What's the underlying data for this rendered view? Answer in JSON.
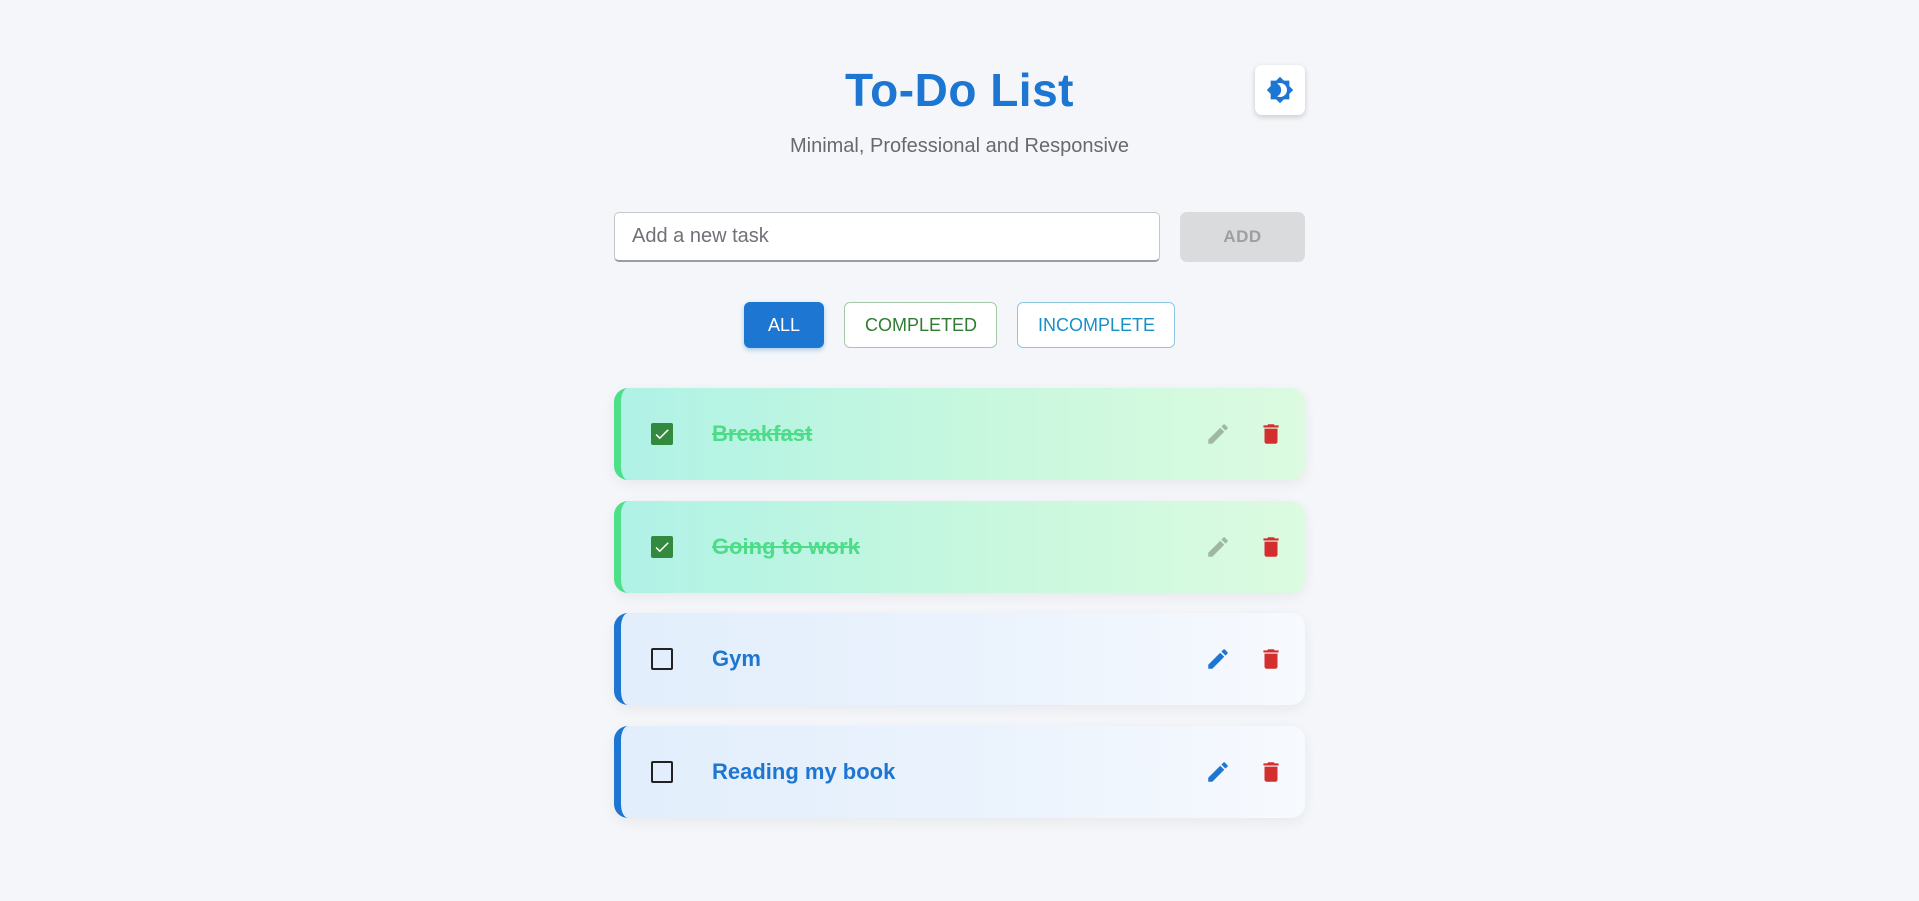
{
  "header": {
    "title": "To-Do List",
    "subtitle": "Minimal, Professional and Responsive",
    "theme_toggle_icon": "brightness-icon"
  },
  "add_task": {
    "placeholder": "Add a new task",
    "value": "",
    "button_label": "ADD"
  },
  "filters": [
    {
      "label": "ALL",
      "active": true
    },
    {
      "label": "COMPLETED",
      "active": false
    },
    {
      "label": "INCOMPLETE",
      "active": false
    }
  ],
  "tasks": [
    {
      "label": "Breakfast",
      "completed": true
    },
    {
      "label": "Going to work",
      "completed": true
    },
    {
      "label": "Gym",
      "completed": false
    },
    {
      "label": "Reading my book",
      "completed": false
    }
  ],
  "colors": {
    "accent": "#1c76d2",
    "completed_text": "#4ddc87",
    "completed_checkbox": "#338a3e",
    "delete": "#d32f2f",
    "edit_disabled": "#9fb8a6"
  }
}
